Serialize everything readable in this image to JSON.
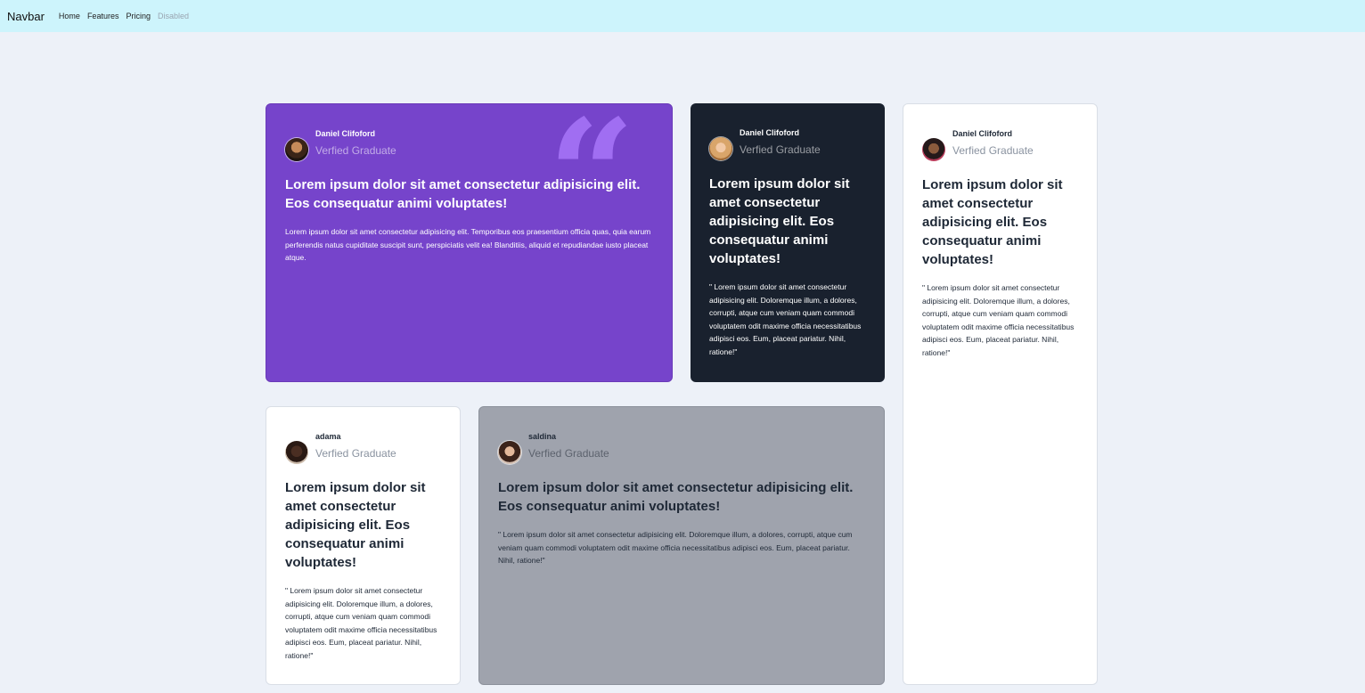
{
  "navbar": {
    "brand": "Navbar",
    "links": [
      "Home",
      "Features",
      "Pricing",
      "Disabled"
    ]
  },
  "cards": [
    {
      "name": "Daniel Clifoford",
      "role": "Verfied Graduate",
      "headline": "Lorem ipsum dolor sit amet consectetur adipisicing elit. Eos consequatur animi voluptates!",
      "body": "Lorem ipsum dolor sit amet consectetur adipisicing elit. Temporibus eos praesentium officia quas, quia earum perferendis natus cupiditate suscipit sunt, perspiciatis velit ea! Blanditiis, aliquid et repudiandae iusto placeat atque.",
      "theme": "#7644cb"
    },
    {
      "name": "Daniel Clifoford",
      "role": "Verfied Graduate",
      "headline": "Lorem ipsum dolor sit amet consectetur adipisicing elit. Eos consequatur animi voluptates!",
      "body": "\" Lorem ipsum dolor sit amet consectetur adipisicing elit. Doloremque illum, a dolores, corrupti, atque cum veniam quam commodi voluptatem odit maxime officia necessitatibus adipisci eos. Eum, placeat pariatur. Nihil, ratione!\"",
      "theme": "#19212e"
    },
    {
      "name": "Daniel Clifoford",
      "role": "Verfied Graduate",
      "headline": "Lorem ipsum dolor sit amet consectetur adipisicing elit. Eos consequatur animi voluptates!",
      "body": "\" Lorem ipsum dolor sit amet consectetur adipisicing elit. Doloremque illum, a dolores, corrupti, atque cum veniam quam commodi voluptatem odit maxime officia necessitatibus adipisci eos. Eum, placeat pariatur. Nihil, ratione!\"",
      "theme": "#ffffff"
    },
    {
      "name": "adama",
      "role": "Verfied Graduate",
      "headline": "Lorem ipsum dolor sit amet consectetur adipisicing elit. Eos consequatur animi voluptates!",
      "body": "\" Lorem ipsum dolor sit amet consectetur adipisicing elit. Doloremque illum, a dolores, corrupti, atque cum veniam quam commodi voluptatem odit maxime officia necessitatibus adipisci eos. Eum, placeat pariatur. Nihil, ratione!\"",
      "theme": "#ffffff"
    },
    {
      "name": "saldina",
      "role": "Verfied Graduate",
      "headline": "Lorem ipsum dolor sit amet consectetur adipisicing elit. Eos consequatur animi voluptates!",
      "body": "\" Lorem ipsum dolor sit amet consectetur adipisicing elit. Doloremque illum, a dolores, corrupti, atque cum veniam quam commodi voluptatem odit maxime officia necessitatibus adipisci eos. Eum, placeat pariatur. Nihil, ratione!\"",
      "theme": "#9fa3ad"
    }
  ],
  "icons": {
    "quote": "quote-icon",
    "avatar": "avatar-photo"
  }
}
